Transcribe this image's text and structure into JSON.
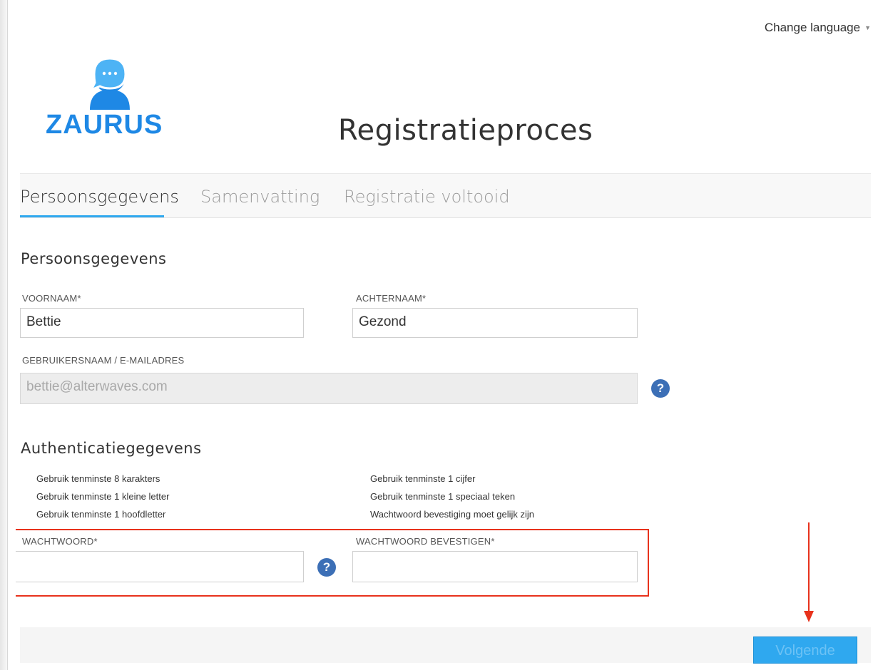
{
  "header": {
    "change_language": "Change language",
    "logo_text": "ZAURUS",
    "page_title": "Registratieproces"
  },
  "tabs": [
    {
      "label": "Persoonsgegevens",
      "active": true
    },
    {
      "label": "Samenvatting",
      "active": false
    },
    {
      "label": "Registratie voltooid",
      "active": false
    }
  ],
  "personal": {
    "section_title": "Persoonsgegevens",
    "first_name_label": "VOORNAAM*",
    "first_name_value": "Bettie",
    "last_name_label": "ACHTERNAAM*",
    "last_name_value": "Gezond",
    "username_label": "GEBRUIKERSNAAM / E-MAILADRES",
    "username_value": "bettie@alterwaves.com",
    "help_glyph": "?"
  },
  "auth": {
    "section_title": "Authenticatiegegevens",
    "rules_left": [
      "Gebruik tenminste 8 karakters",
      "Gebruik tenminste 1 kleine letter",
      "Gebruik tenminste 1 hoofdletter"
    ],
    "rules_right": [
      "Gebruik tenminste 1 cijfer",
      "Gebruik tenminste 1 speciaal teken",
      "Wachtwoord bevestiging moet gelijk zijn"
    ],
    "password_label": "WACHTWOORD*",
    "password_value": "",
    "confirm_label": "WACHTWOORD BEVESTIGEN*",
    "confirm_value": ""
  },
  "footer": {
    "next_label": "Volgende"
  },
  "colors": {
    "accent": "#2fa8ef",
    "logo": "#1e88e5",
    "help": "#3c6fb6",
    "annotation": "#e8321c"
  }
}
